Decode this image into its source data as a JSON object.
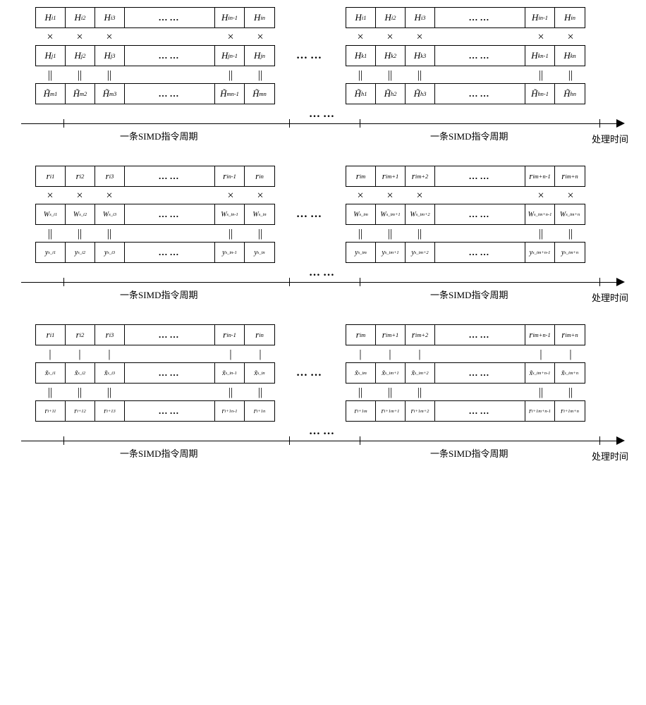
{
  "dots_inline": "……",
  "dots_gap": "……",
  "op_mult": "×",
  "op_eq": "||",
  "op_minus": "|",
  "timeline": {
    "simd_label": "一条SIMD指令周期",
    "axis_label": "处理时间",
    "dots": "……"
  },
  "sections": [
    {
      "left": {
        "row0": [
          "H_{i1}",
          "H_{i2}",
          "H_{i3}",
          "…",
          "H_{in-1}",
          "H_{in}"
        ],
        "row1": [
          "H_{j1}",
          "H_{j2}",
          "H_{j3}",
          "…",
          "H_{jn-1}",
          "H_{jn}"
        ],
        "row2": [
          "H̃_{m1}",
          "H̃_{m2}",
          "H̃_{m3}",
          "…",
          "H̃_{mn-1}",
          "H̃_{mn}"
        ]
      },
      "right": {
        "row0": [
          "H_{i1}",
          "H_{i2}",
          "H_{i3}",
          "…",
          "H_{in-1}",
          "H_{in}"
        ],
        "row1": [
          "H_{k1}",
          "H_{k2}",
          "H_{k3}",
          "…",
          "H_{kn-1}",
          "H_{kn}"
        ],
        "row2": [
          "H̃_{h1}",
          "H̃_{h2}",
          "H̃_{h3}",
          "…",
          "H̃_{hn-1}",
          "H̃_{hn}"
        ]
      },
      "ops": [
        "×",
        "×",
        "×",
        "",
        "×",
        "×"
      ],
      "ops2": [
        "||",
        "||",
        "||",
        "",
        "||",
        "||"
      ]
    },
    {
      "left": {
        "row0": [
          "r_{i1}",
          "r_{i2}",
          "r_{i3}",
          "…",
          "r_{in-1}",
          "r_{in}"
        ],
        "row1": [
          "W_{s_i1}",
          "W_{s_i2}",
          "W_{s_i3}",
          "…",
          "W_{s_in-1}",
          "W_{s_in}"
        ],
        "row2": [
          "y_{s_i1}",
          "y_{s_i2}",
          "y_{s_i3}",
          "…",
          "y_{s_in-1}",
          "y_{s_in}"
        ]
      },
      "right": {
        "row0": [
          "r_{im}",
          "r_{im+1}",
          "r_{im+2}",
          "…",
          "r_{im+n-1}",
          "r_{im+n}"
        ],
        "row1": [
          "W_{s_im}",
          "W_{s_im+1}",
          "W_{s_im+2}",
          "…",
          "W_{s_im+n-1}",
          "W_{s_im+n}"
        ],
        "row2": [
          "y_{s_im}",
          "y_{s_im+1}",
          "y_{s_im+2}",
          "…",
          "y_{s_im+n-1}",
          "y_{s_im+n}"
        ]
      },
      "ops": [
        "×",
        "×",
        "×",
        "",
        "×",
        "×"
      ],
      "ops2": [
        "||",
        "||",
        "||",
        "",
        "||",
        "||"
      ]
    },
    {
      "left": {
        "row0": [
          "r_{i1}",
          "r_{i2}",
          "r_{i3}",
          "…",
          "r_{in-1}",
          "r_{in}"
        ],
        "row1": [
          "x̃_{s_i1}",
          "x̃_{s_i2}",
          "x̃_{s_i3}",
          "…",
          "x̃_{s_in-1}",
          "x̃_{s_in}"
        ],
        "row2": [
          "r_{i+11}",
          "r_{i+12}",
          "r_{i+13}",
          "…",
          "r_{i+1n-1}",
          "r_{i+1n}"
        ]
      },
      "right": {
        "row0": [
          "r_{im}",
          "r_{im+1}",
          "r_{im+2}",
          "…",
          "r_{im+n-1}",
          "r_{im+n}"
        ],
        "row1": [
          "x̃_{s_im}",
          "x̃_{s_im+1}",
          "x̃_{s_im+2}",
          "…",
          "x̃_{s_im+n-1}",
          "x̃_{s_im+n}"
        ],
        "row2": [
          "r_{i+1m}",
          "r_{i+1m+1}",
          "r_{i+1m+2}",
          "…",
          "r_{i+1m+n-1}",
          "r_{i+1m+n}"
        ]
      },
      "ops": [
        "|",
        "|",
        "|",
        "",
        "|",
        "|"
      ],
      "ops2": [
        "||",
        "||",
        "||",
        "",
        "||",
        "||"
      ]
    }
  ]
}
